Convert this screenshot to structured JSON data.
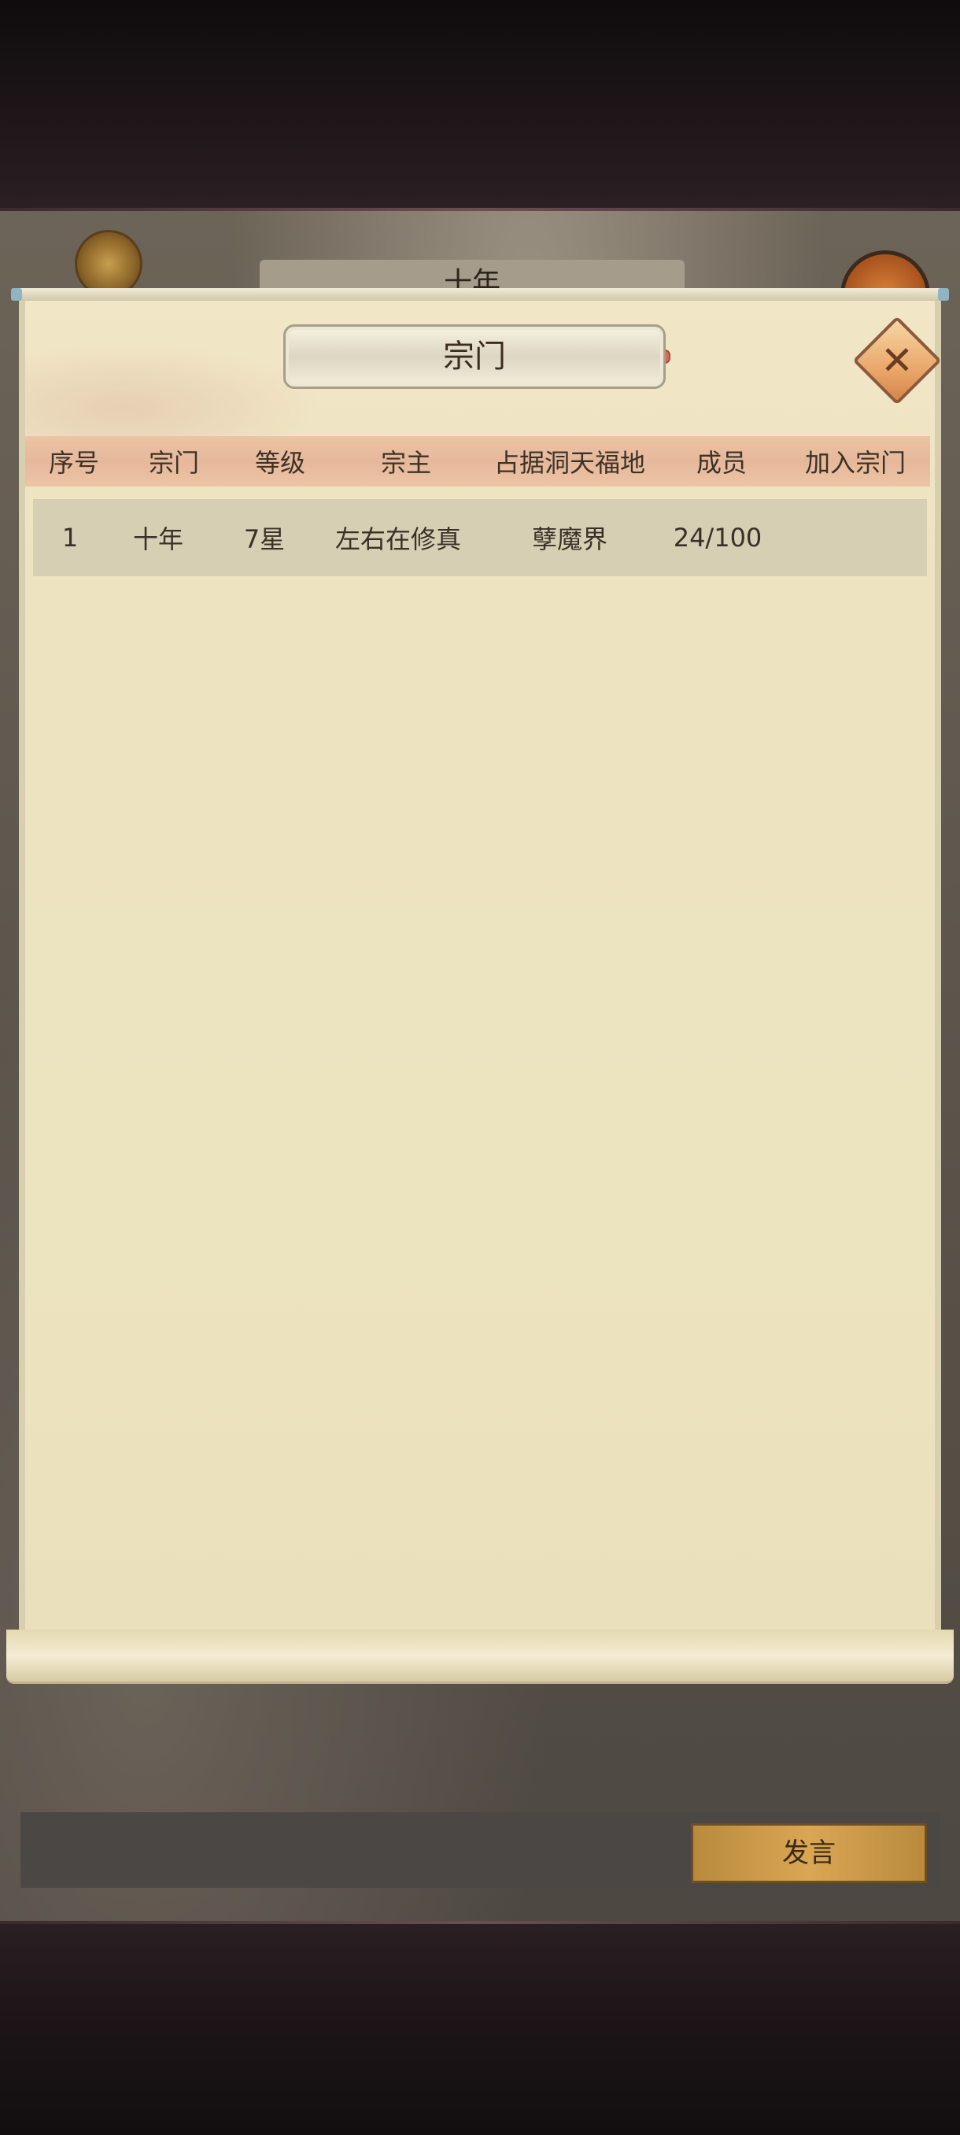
{
  "background": {
    "title": "十年"
  },
  "dialog": {
    "title": "宗门",
    "close_icon": "close-icon"
  },
  "table": {
    "columns": [
      "序号",
      "宗门",
      "等级",
      "宗主",
      "占据洞天福地",
      "成员",
      "加入宗门"
    ],
    "rows": [
      [
        "1",
        "十年",
        "7星",
        "左右在修真",
        "孽魔界",
        "24/100",
        ""
      ]
    ]
  },
  "chat": {
    "input_value": "",
    "send_label": "发言"
  }
}
